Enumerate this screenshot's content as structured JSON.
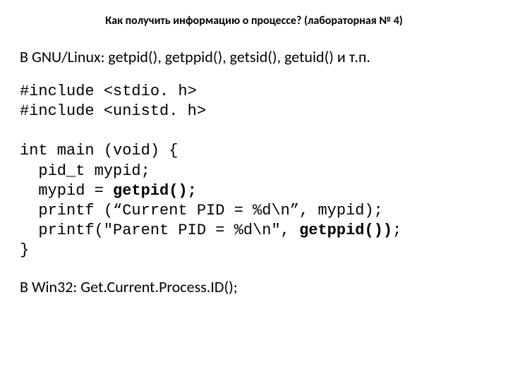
{
  "title": "Как получить информацию о процессе? (лабораторная № 4)",
  "subtitle": "В GNU/Linux: getpid(), getppid(), getsid(), getuid() и т.п.",
  "code": {
    "l1": "#include <stdio. h>",
    "l2": "#include <unistd. h>",
    "l3": "",
    "l4": "int main (void) {",
    "l5": "  pid_t mypid;",
    "l6a": "  mypid = ",
    "l6b": "getpid();",
    "l7": "  printf (“Current PID = %d\\n”, mypid);",
    "l8a": "  printf(\"Parent PID = %d\\n\", ",
    "l8b": "getppid())",
    "l8c": ";",
    "l9": "}"
  },
  "footer": "В Win32: Get.Current.Process.ID();"
}
